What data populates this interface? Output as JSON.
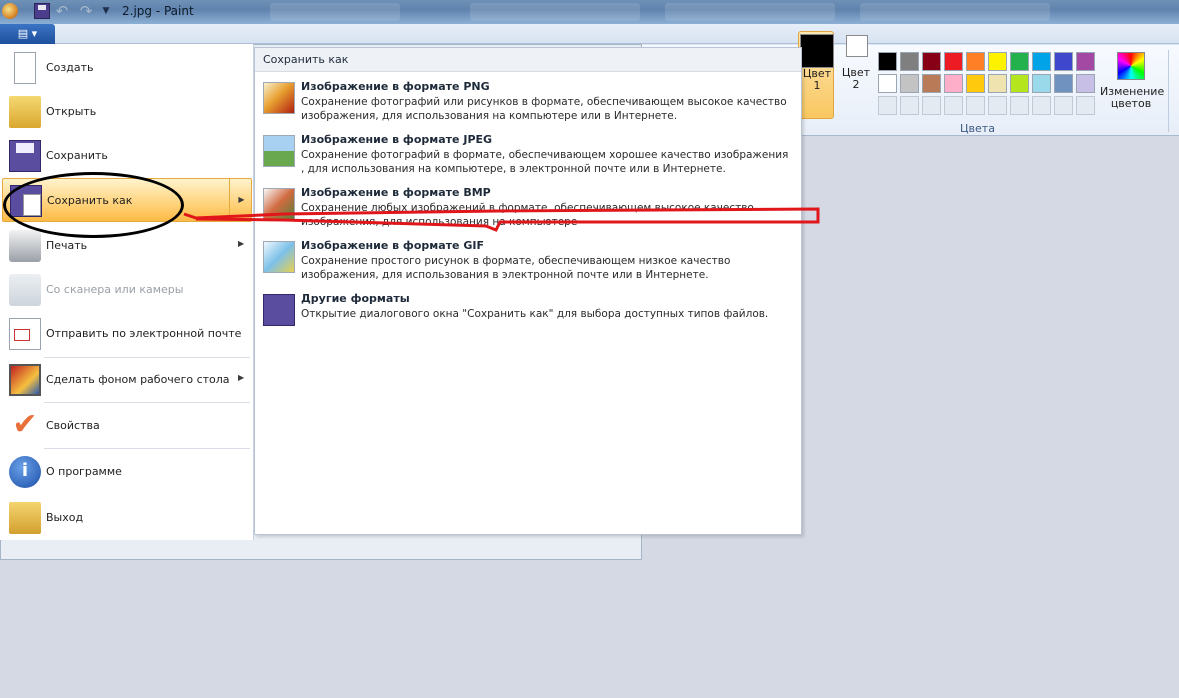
{
  "window": {
    "title": "2.jpg - Paint"
  },
  "ribbon": {
    "color1_label": "Цвет 1",
    "color2_label": "Цвет 2",
    "colors_group_label": "Цвета",
    "edit_colors_label": "Изменение цветов",
    "palette_row1": [
      "#000000",
      "#7f7f7f",
      "#880015",
      "#ed1c24",
      "#ff7f27",
      "#fff200",
      "#22b14c",
      "#00a2e8",
      "#3f48cc",
      "#a349a4"
    ],
    "palette_row2": [
      "#ffffff",
      "#c3c3c3",
      "#b97a57",
      "#ffaec9",
      "#ffc90e",
      "#efe4b0",
      "#b5e61d",
      "#99d9ea",
      "#7092be",
      "#c8bfe7"
    ]
  },
  "file_menu": {
    "items": [
      {
        "label": "Создать",
        "icon": "new-file-icon"
      },
      {
        "label": "Открыть",
        "icon": "open-folder-icon"
      },
      {
        "label": "Сохранить",
        "icon": "save-icon"
      },
      {
        "label": "Сохранить как",
        "icon": "save-as-icon",
        "submenu": true,
        "selected": true
      },
      {
        "label": "Печать",
        "icon": "printer-icon",
        "submenu": true
      },
      {
        "label": "Со сканера или камеры",
        "icon": "scanner-icon",
        "disabled": true
      },
      {
        "label": "Отправить по электронной почте",
        "icon": "email-icon"
      },
      {
        "label": "Сделать фоном рабочего стола",
        "icon": "desktop-icon",
        "submenu": true
      },
      {
        "label": "Свойства",
        "icon": "checkmark-icon"
      },
      {
        "label": "О программе",
        "icon": "info-icon"
      },
      {
        "label": "Выход",
        "icon": "exit-icon"
      }
    ]
  },
  "save_as_submenu": {
    "header": "Сохранить как",
    "items": [
      {
        "title": "Изображение в формате PNG",
        "desc": "Сохранение фотографий или рисунков в формате, обеспечивающем высокое качество изображения, для использования на компьютере или в Интернете."
      },
      {
        "title": "Изображение в формате JPEG",
        "desc": "Сохранение фотографий в формате, обеспечивающем хорошее качество изображения , для использования на компьютере, в электронной почте или в Интернете."
      },
      {
        "title": "Изображение в формате BMP",
        "desc": "Сохранение любых изображений в формате, обеспечивающем высокое качество изображения, для использования на компьютере"
      },
      {
        "title": "Изображение в формате GIF",
        "desc": "Сохранение простого рисунок в формате, обеспечивающем низкое качество изображения, для использования в электронной почте или в Интернете."
      },
      {
        "title": "Другие форматы",
        "desc": "Открытие диалогового окна \"Сохранить как\" для выбора доступных типов файлов."
      }
    ]
  },
  "annotation_color": "#e0161b"
}
